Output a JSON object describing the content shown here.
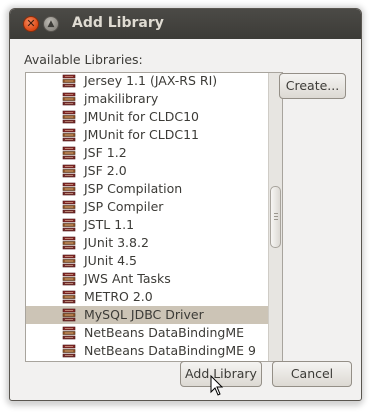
{
  "window": {
    "title": "Add Library",
    "close_glyph": "✕",
    "maximize_glyph": "▲"
  },
  "available_label": "Available Libraries:",
  "libraries": [
    {
      "name": "Jersey 1.1 (JAX-RS RI)",
      "selected": false
    },
    {
      "name": "jmakilibrary",
      "selected": false
    },
    {
      "name": "JMUnit for CLDC10",
      "selected": false
    },
    {
      "name": "JMUnit for CLDC11",
      "selected": false
    },
    {
      "name": "JSF 1.2",
      "selected": false
    },
    {
      "name": "JSF 2.0",
      "selected": false
    },
    {
      "name": "JSP Compilation",
      "selected": false
    },
    {
      "name": "JSP Compiler",
      "selected": false
    },
    {
      "name": "JSTL 1.1",
      "selected": false
    },
    {
      "name": "JUnit 3.8.2",
      "selected": false
    },
    {
      "name": "JUnit 4.5",
      "selected": false
    },
    {
      "name": "JWS Ant Tasks",
      "selected": false
    },
    {
      "name": "METRO 2.0",
      "selected": false
    },
    {
      "name": "MySQL JDBC Driver",
      "selected": true
    },
    {
      "name": "NetBeans DataBindingME",
      "selected": false
    },
    {
      "name": "NetBeans DataBindingME 9",
      "selected": false
    }
  ],
  "buttons": {
    "create": "Create...",
    "add_library": "Add Library",
    "cancel": "Cancel"
  },
  "colors": {
    "selection": "#ccc4b6",
    "titlebar": "#3c3b37",
    "close_button": "#dd4814"
  },
  "icons": {
    "library": "jar-library-icon",
    "cursor": "mouse-pointer-icon"
  }
}
